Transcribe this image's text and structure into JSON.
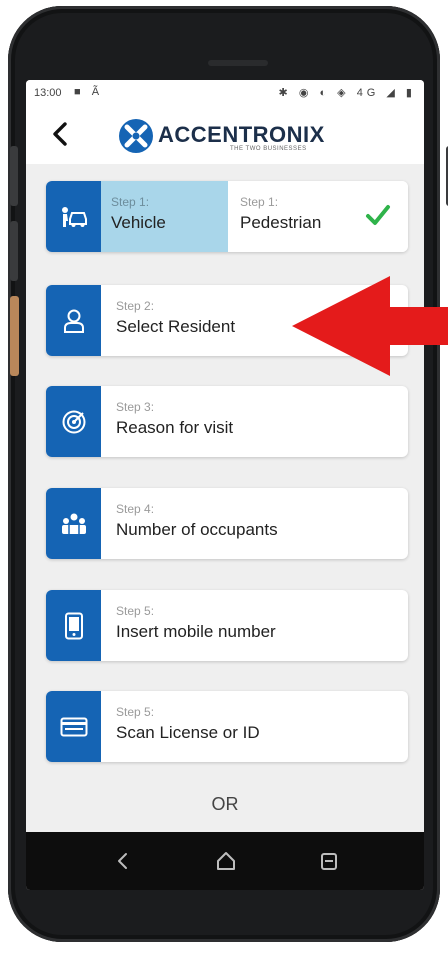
{
  "status_bar": {
    "time": "13:00",
    "left_icons": "■ Ã",
    "right_icons": "✱ ◉ ◐ ◈ 4G ◢ ▮"
  },
  "header": {
    "back_icon": "chevron-left-icon",
    "logo_text": "ACCENTRONIX",
    "logo_tagline": "THE TWO BUSINESSES"
  },
  "steps": {
    "step1": {
      "vehicle_small": "Step 1:",
      "vehicle_label": "Vehicle",
      "pedestrian_small": "Step 1:",
      "pedestrian_label": "Pedestrian",
      "selected": "Pedestrian",
      "icon": "vehicle-pedestrian-icon",
      "check_icon": "checkmark-icon"
    },
    "step2": {
      "small": "Step 2:",
      "label": "Select Resident",
      "icon": "person-icon"
    },
    "step3": {
      "small": "Step 3:",
      "label": "Reason for visit",
      "icon": "target-icon"
    },
    "step4": {
      "small": "Step 4:",
      "label": "Number of occupants",
      "icon": "group-icon"
    },
    "step5": {
      "small": "Step 5:",
      "label": "Insert mobile number",
      "icon": "mobile-phone-icon"
    },
    "step6": {
      "small": "Step 5:",
      "label": "Scan License or ID",
      "icon": "id-card-icon"
    }
  },
  "or_label": "OR",
  "colors": {
    "brand_blue": "#1564b4",
    "selected_bg": "#a9d6ea",
    "check_green": "#2fb34a",
    "arrow_red": "#e41b1b"
  },
  "nav_bar": {
    "back": "nav-back-icon",
    "home": "nav-home-icon",
    "recent": "nav-recent-icon"
  }
}
